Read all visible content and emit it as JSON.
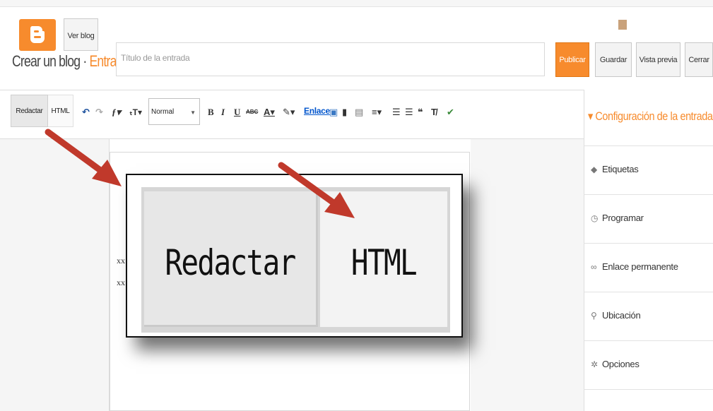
{
  "header": {
    "view_blog": "Ver blog",
    "heading_prefix": "Crear un blog · ",
    "heading_accent": "Entrada",
    "title_placeholder": "Título de la entrada",
    "buttons": {
      "publish": "Publicar",
      "save": "Guardar",
      "preview": "Vista previa",
      "close": "Cerrar"
    }
  },
  "editor": {
    "mode_compose": "Redactar",
    "mode_html": "HTML",
    "format_select": "Normal",
    "link_label": "Enlace",
    "body_lines": [
      "xx",
      "xx"
    ]
  },
  "sidebar": {
    "title": "Configuración de la entrada",
    "items": [
      {
        "label": "Etiquetas",
        "icon": "tag-icon"
      },
      {
        "label": "Programar",
        "icon": "clock-icon"
      },
      {
        "label": "Enlace permanente",
        "icon": "link-icon"
      },
      {
        "label": "Ubicación",
        "icon": "location-pin-icon"
      },
      {
        "label": "Opciones",
        "icon": "gear-icon"
      }
    ]
  },
  "callout": {
    "compose": "Redactar",
    "html": "HTML"
  },
  "colors": {
    "brand_orange": "#f78b2d",
    "arrow_red": "#c0392b",
    "link_blue": "#0055cc"
  }
}
